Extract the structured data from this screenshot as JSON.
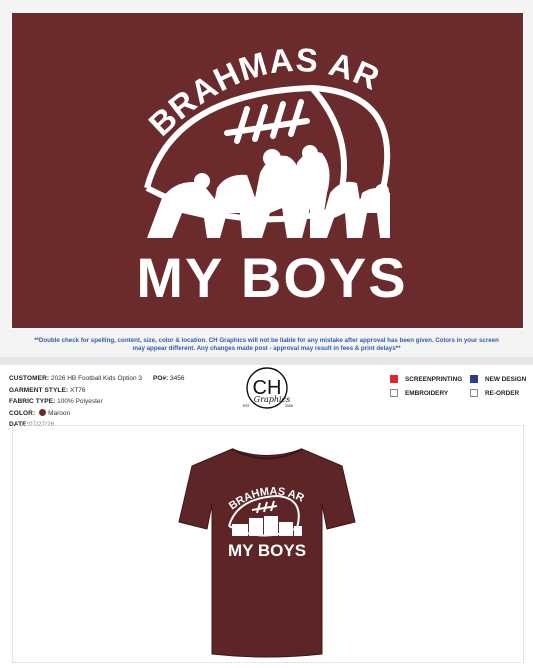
{
  "design": {
    "line1": "BRAHMAS ARE",
    "line2": "MY BOYS",
    "background_color": "#6b2a2b",
    "ink_color": "#ffffff"
  },
  "disclaimer": "**Double check for spelling, content, size, color & location. CH Graphics will not be liable for any mistake after approval has been given. Colors in your screen may appear different. Any changes made post - approval may result in fees & print delays**",
  "order": {
    "customer_label": "CUSTOMER:",
    "customer_value": "2026 HB Football Kids Option 3",
    "po_label": "PO#:",
    "po_value": "3456",
    "garment_label": "GARMENT STYLE:",
    "garment_value": "XT76",
    "fabric_label": "FABRIC TYPE:",
    "fabric_value": "100% Polyester",
    "color_label": "COLOR:",
    "color_value": "Maroon",
    "date_label": "DATE:",
    "date_value": "07/27/26"
  },
  "logo": {
    "letters": "CH",
    "script": "Graphics",
    "est": "EST.",
    "year": "2008"
  },
  "options": {
    "screenprinting": "SCREENPRINTING",
    "embroidery": "EMBROIDERY",
    "new_design": "NEW DESIGN",
    "reorder": "RE-ORDER",
    "screenprinting_color": "#e3212b",
    "new_design_color": "#2b3a8f"
  },
  "garment_color": "#5e2526"
}
